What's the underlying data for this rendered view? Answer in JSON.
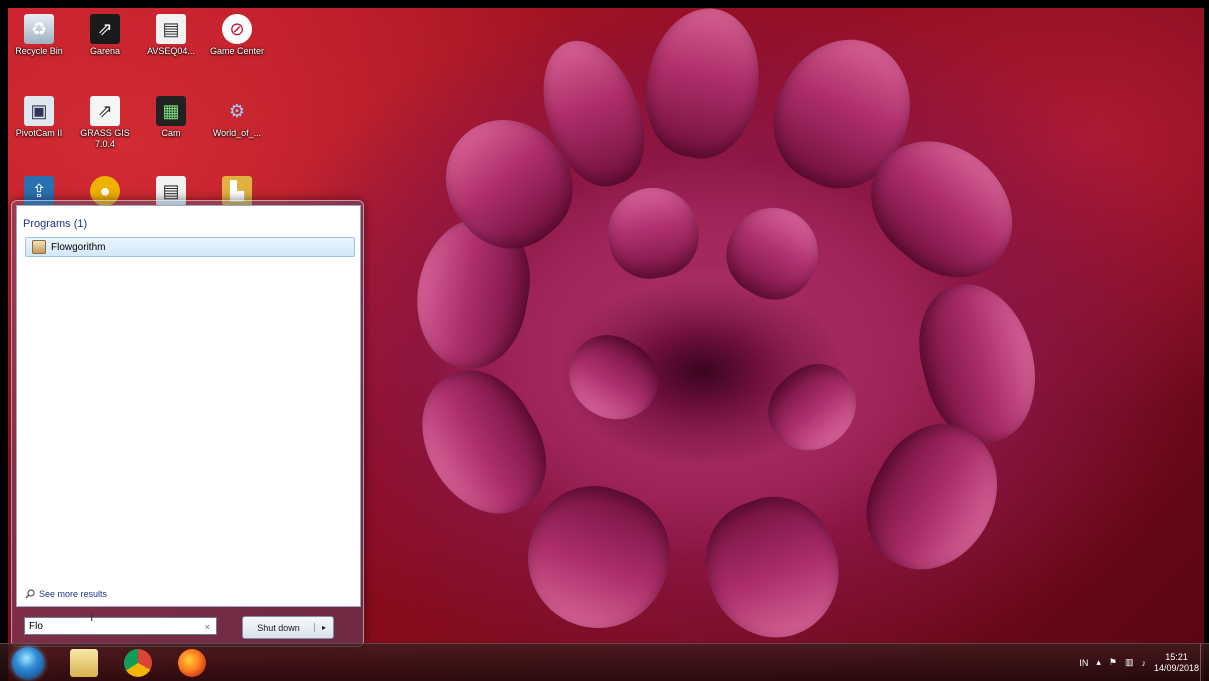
{
  "desktop": {
    "icons": [
      {
        "label": "Recycle Bin",
        "icon": "recycle-bin-icon"
      },
      {
        "label": "Garena",
        "icon": "garena-icon"
      },
      {
        "label": "AVSEQ04...",
        "icon": "document-icon"
      },
      {
        "label": "Game Center",
        "icon": "game-center-icon"
      },
      {
        "label": "PivotCam II",
        "icon": "app-icon"
      },
      {
        "label": "GRASS GIS 7.0.4",
        "icon": "grass-gis-icon"
      },
      {
        "label": "Cam",
        "icon": "cam-icon"
      },
      {
        "label": "World_of_...",
        "icon": "world-icon"
      }
    ]
  },
  "start_menu": {
    "programs_header": "Programs (1)",
    "program_item": "Flowgorithm",
    "see_more": "See more results",
    "search_value": "Flo",
    "clear_glyph": "×",
    "shutdown_label": "Shut down",
    "shutdown_arrow": "▸"
  },
  "taskbar": {
    "apps": [
      "windows-explorer-icon",
      "chrome-icon",
      "firefox-icon"
    ],
    "tray": {
      "language": "IN",
      "time": "15:21",
      "date": "14/09/2018"
    }
  }
}
